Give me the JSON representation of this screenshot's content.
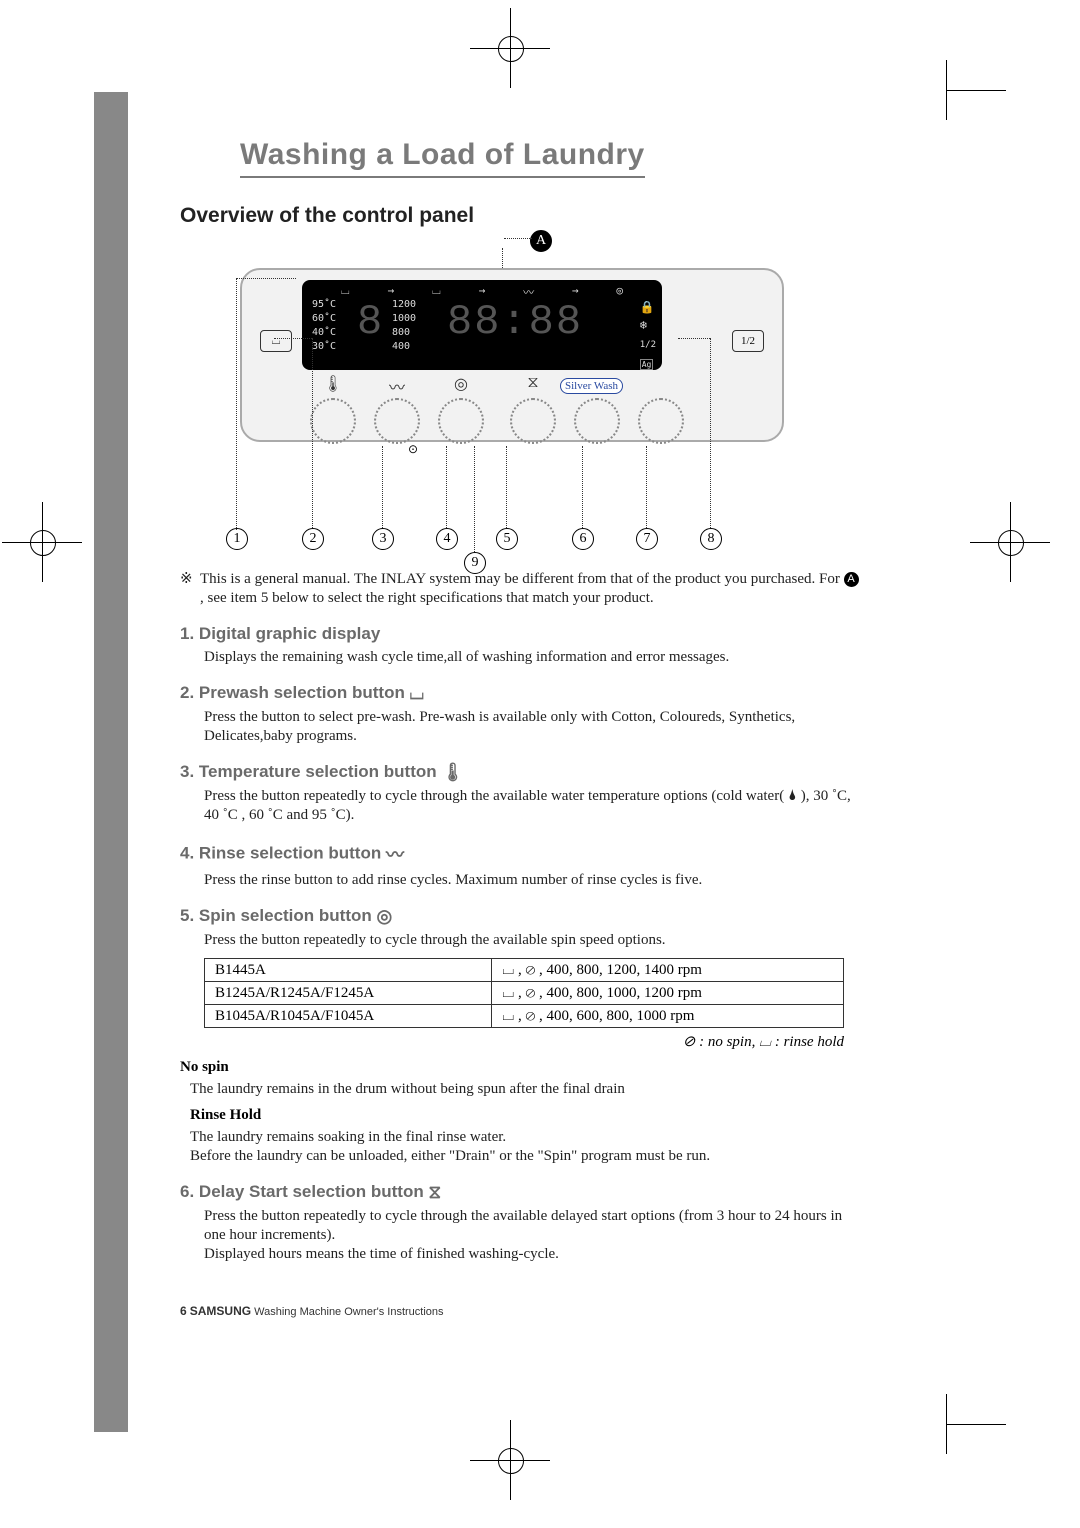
{
  "page": {
    "title": "Washing a Load of Laundry",
    "section_title": "Overview of the control panel",
    "page_number": "6",
    "brand": "SAMSUNG",
    "footer_text": "Washing Machine Owner's Instructions"
  },
  "panel": {
    "callout_a": "A",
    "temps": [
      "95˚C",
      "60˚C",
      "40˚C",
      "30˚C"
    ],
    "speeds": [
      "1200",
      "1000",
      "800",
      "400"
    ],
    "side_left": "⌴",
    "side_right": "1/2",
    "silverwash": "Silver Wash",
    "callouts": [
      "1",
      "2",
      "3",
      "4",
      "5",
      "6",
      "7",
      "8",
      "9"
    ]
  },
  "note": {
    "text1": "This is a general manual. The INLAY system may be different from that of the product you purchased. For ",
    "text2": ", see item 5 below to select the right specifications that match your product.",
    "a_label": "A"
  },
  "items": [
    {
      "num": "1.",
      "title": "Digital graphic display",
      "icon": "",
      "body": "Displays the remaining wash cycle time,all of washing information and error messages."
    },
    {
      "num": "2.",
      "title": "Prewash selection button",
      "icon": "⌴",
      "body": "Press the button to select pre-wash. Pre-wash is available only with Cotton, Coloureds, Synthetics, Delicates,baby programs."
    },
    {
      "num": "3.",
      "title": "Temperature selection button",
      "icon": "🌡",
      "body": "Press the button  repeatedly to cycle through the available water temperature options (cold water( 🌢 ), 30 ˚C, 40 ˚C , 60 ˚C and 95 ˚C)."
    },
    {
      "num": "4.",
      "title": "Rinse selection button",
      "icon": "〰",
      "body": "Press the rinse button to add rinse cycles. Maximum number of rinse cycles is five."
    },
    {
      "num": "5.",
      "title": "Spin selection button",
      "icon": "◎",
      "body": "Press the button repeatedly to cycle through the available spin speed options."
    },
    {
      "num": "6.",
      "title": "Delay Start selection button",
      "icon": "⧖",
      "body": "Press the button repeatedly to cycle through the available delayed start options (from 3 hour to 24 hours in one hour increments).\nDisplayed hours means the time of finished washing-cycle."
    }
  ],
  "spin_table": {
    "rows": [
      {
        "model": "B1445A",
        "options": "⌴ , ⊘ , 400, 800, 1200, 1400 rpm"
      },
      {
        "model": "B1245A/R1245A/F1245A",
        "options": "⌴ , ⊘ , 400, 800, 1000, 1200 rpm"
      },
      {
        "model": "B1045A/R1045A/F1045A",
        "options": "⌴ , ⊘ , 400, 600,  800, 1000 rpm"
      }
    ],
    "legend": "⊘ : no spin, ⌴ : rinse hold"
  },
  "sub_sections": {
    "nospin_title": "No spin",
    "nospin_text": "The laundry remains in the drum without being spun after the final drain",
    "rinsehold_title": "Rinse Hold",
    "rinsehold_text1": "The laundry remains soaking in the final rinse water.",
    "rinsehold_text2": "Before the laundry can be unloaded, either \"Drain\" or the \"Spin\" program must be run."
  }
}
